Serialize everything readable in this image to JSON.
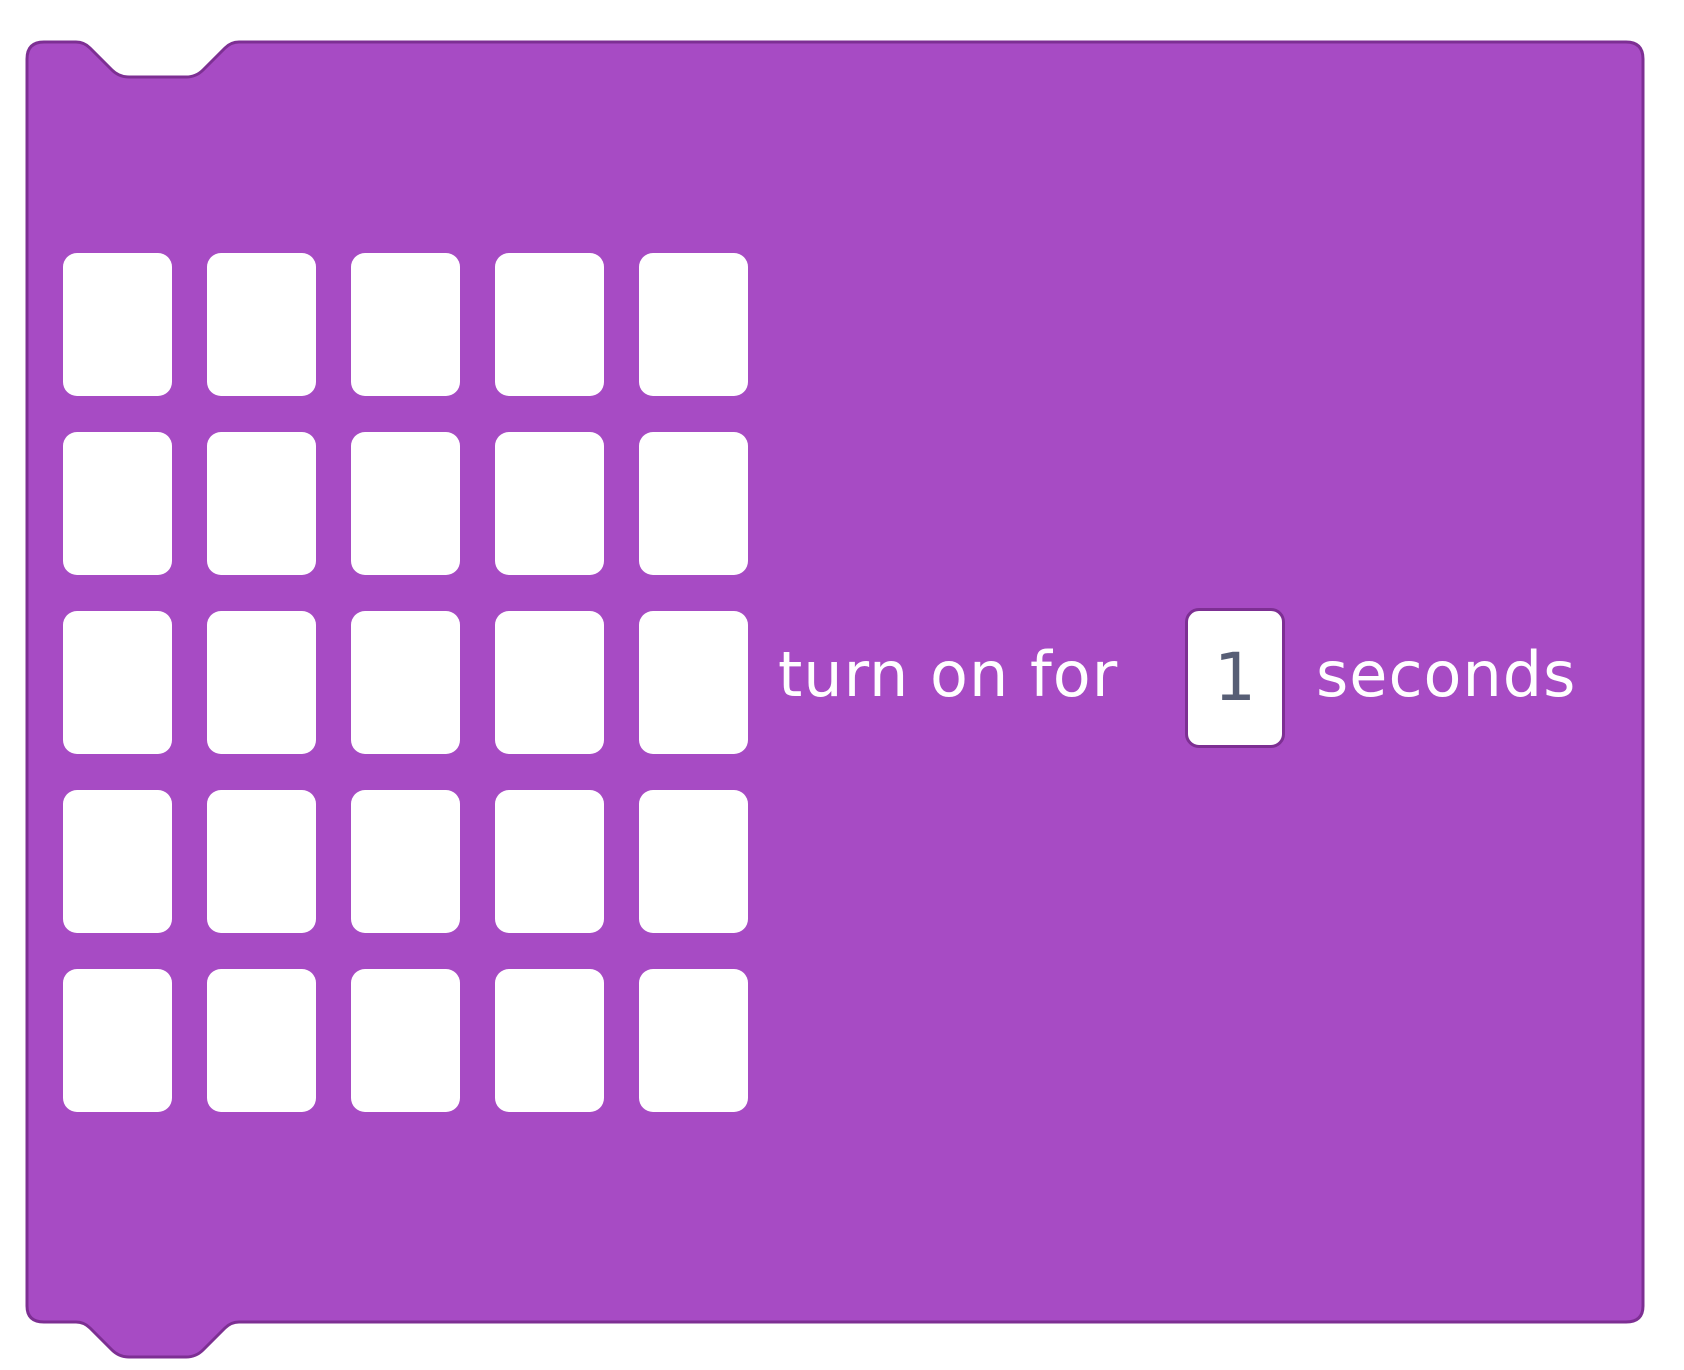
{
  "block": {
    "fill_color": "#a74bc4",
    "border_color": "#7d2f93",
    "led_color": "#ffffff",
    "led_rows": 5,
    "led_cols": 5,
    "prefix_text": "turn on for",
    "duration_value": "1",
    "suffix_text": "seconds"
  }
}
